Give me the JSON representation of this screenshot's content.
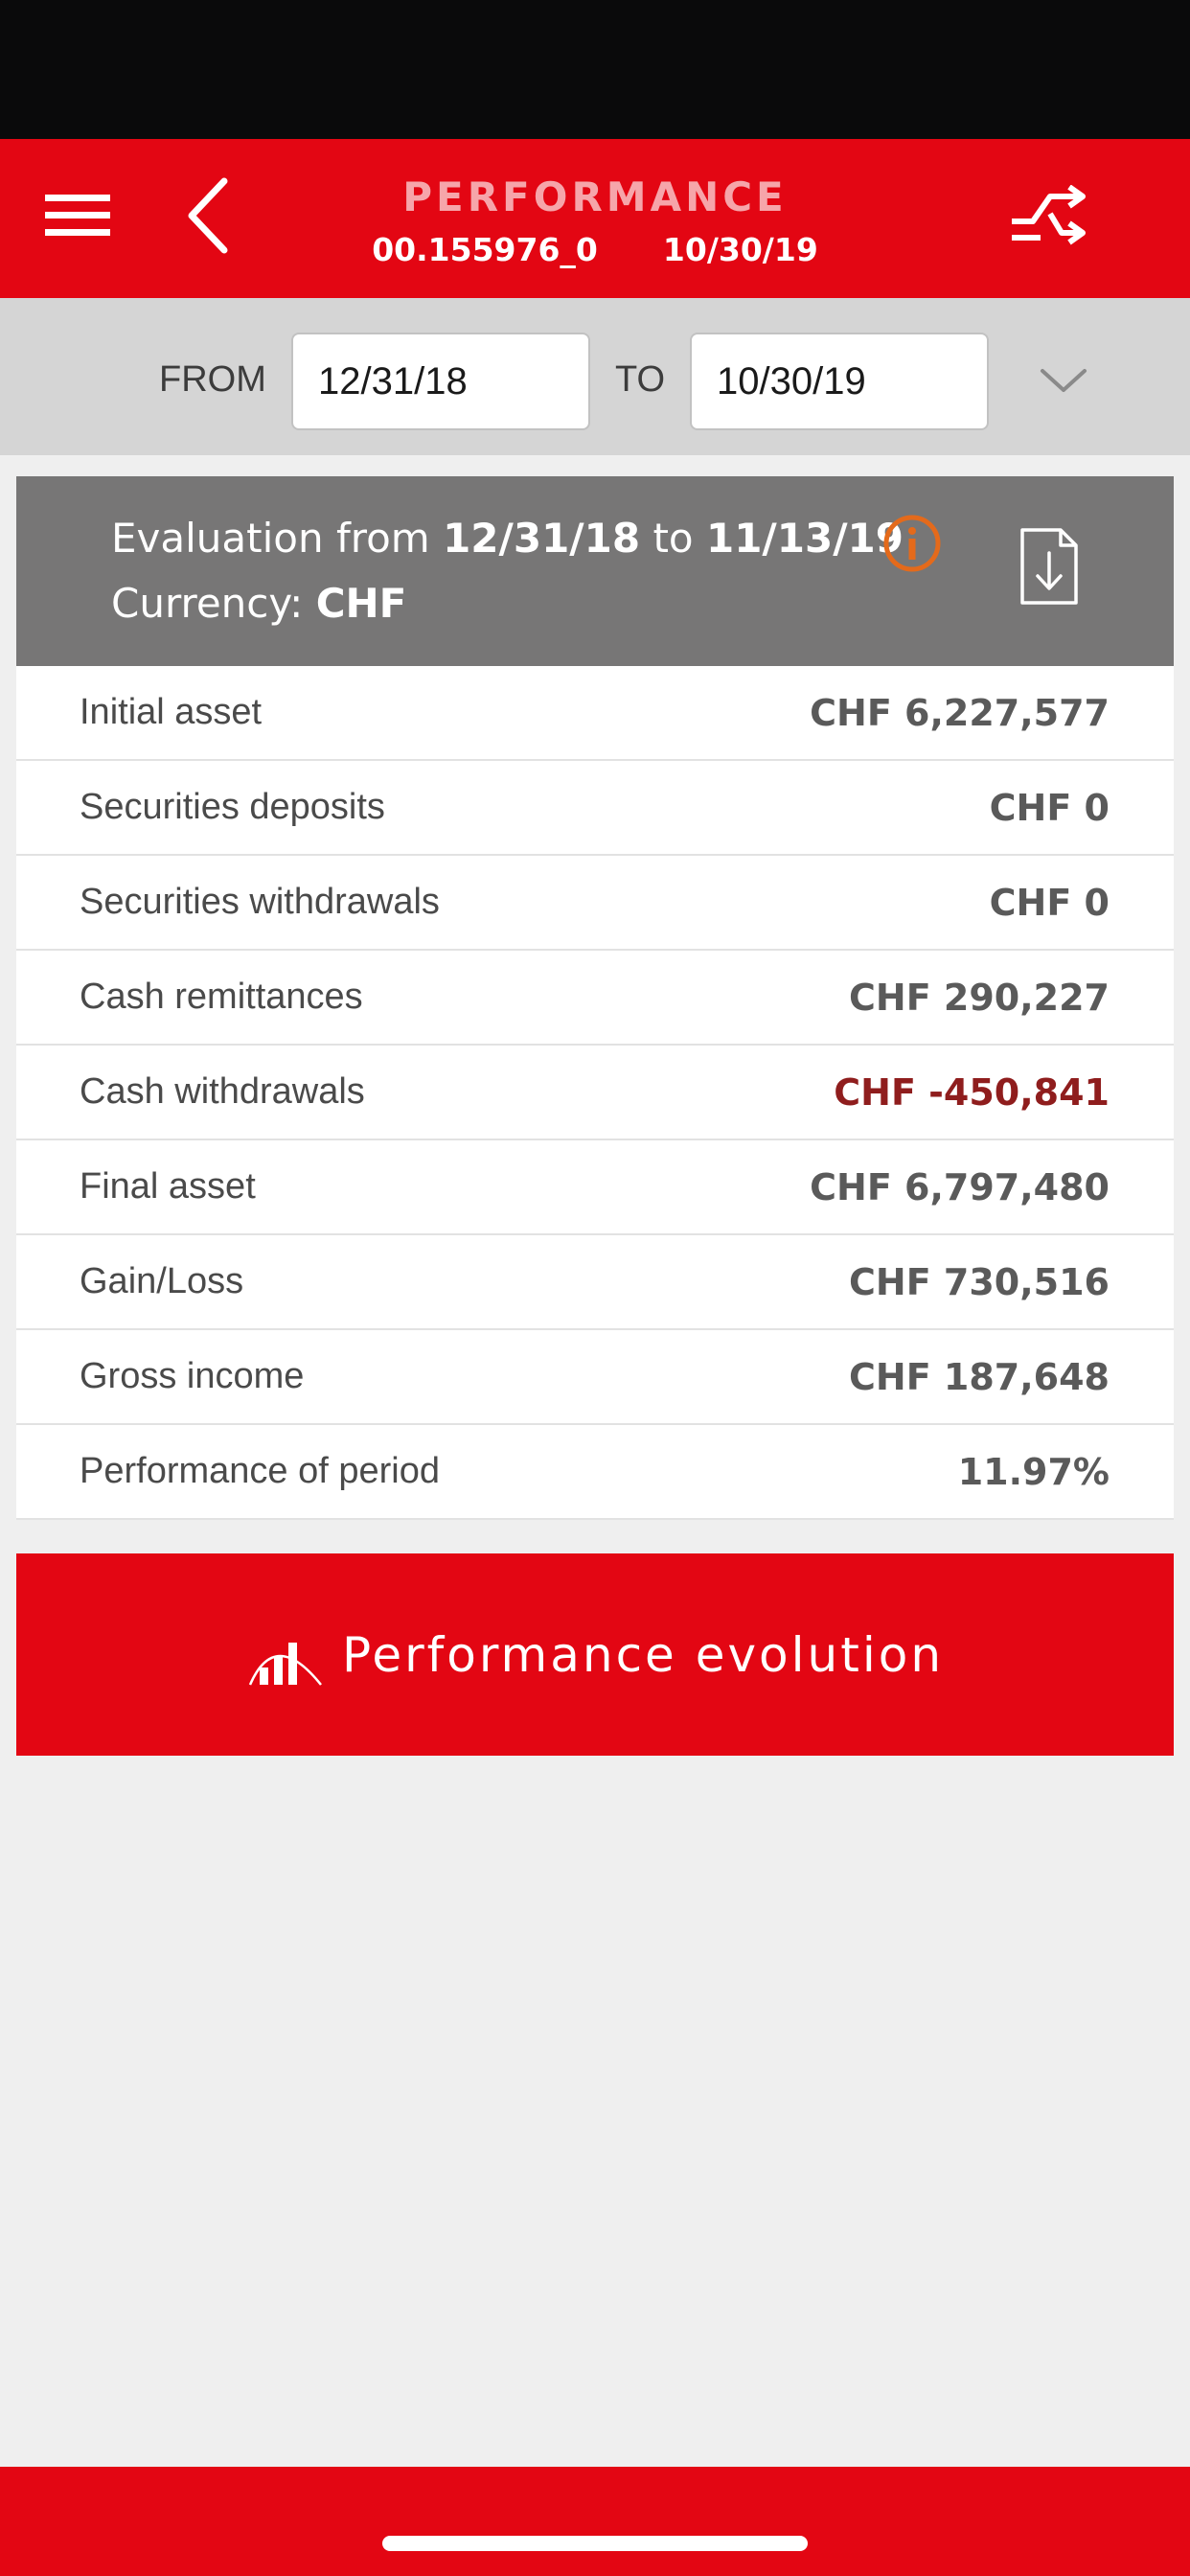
{
  "header": {
    "title": "PERFORMANCE",
    "account": "00.155976_0",
    "date": "10/30/19",
    "icons": {
      "menu": "hamburger-menu-icon",
      "back": "chevron-left-icon",
      "switch": "switch-arrows-icon"
    }
  },
  "date_filter": {
    "from_label": "FROM",
    "from_value": "12/31/18",
    "to_label": "TO",
    "to_value": "10/30/19",
    "expand_icon": "chevron-down-icon"
  },
  "evaluation": {
    "prefix": "Evaluation from",
    "from": "12/31/18",
    "to_word": "to",
    "to": "11/13/19",
    "currency_label": "Currency:",
    "currency": "CHF",
    "icons": {
      "info": "info-icon",
      "download": "download-document-icon"
    },
    "colors": {
      "info": "#e46a1b"
    }
  },
  "rows": [
    {
      "label": "Initial asset",
      "value": "CHF 6,227,577"
    },
    {
      "label": "Securities deposits",
      "value": "CHF 0"
    },
    {
      "label": "Securities withdrawals",
      "value": "CHF 0"
    },
    {
      "label": "Cash remittances",
      "value": "CHF 290,227"
    },
    {
      "label": "Cash withdrawals",
      "value": "CHF -450,841"
    },
    {
      "label": "Final asset",
      "value": "CHF 6,797,480"
    },
    {
      "label": "Gain/Loss",
      "value": "CHF 730,516"
    },
    {
      "label": "Gross income",
      "value": "CHF 187,648"
    },
    {
      "label": "Performance of period",
      "value": "11.97%"
    }
  ],
  "action": {
    "label": "Performance evolution",
    "icon": "bar-chart-icon"
  },
  "colors": {
    "brand_red": "#e30613",
    "header_gray": "#777676",
    "negative": "#8f1d1d"
  }
}
